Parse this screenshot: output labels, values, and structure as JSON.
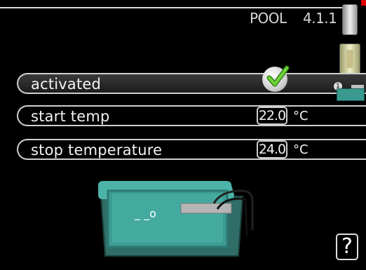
{
  "header": {
    "title": "POOL",
    "menu_number": "4.1.1"
  },
  "rows": [
    {
      "label": "activated",
      "checked": true
    },
    {
      "label": "start temp",
      "value": "22.0",
      "unit": "°C"
    },
    {
      "label": "stop temperature",
      "value": "24.0",
      "unit": "°C"
    }
  ],
  "info_badge": "1",
  "pool_illustration": {
    "thermometer_text": "_ _o"
  },
  "help_button": "?",
  "colors": {
    "background": "#000000",
    "water": "#3a9a90",
    "border": "#cfcfcf",
    "check_green": "#4caa1e",
    "alert_red": "#e10000"
  }
}
